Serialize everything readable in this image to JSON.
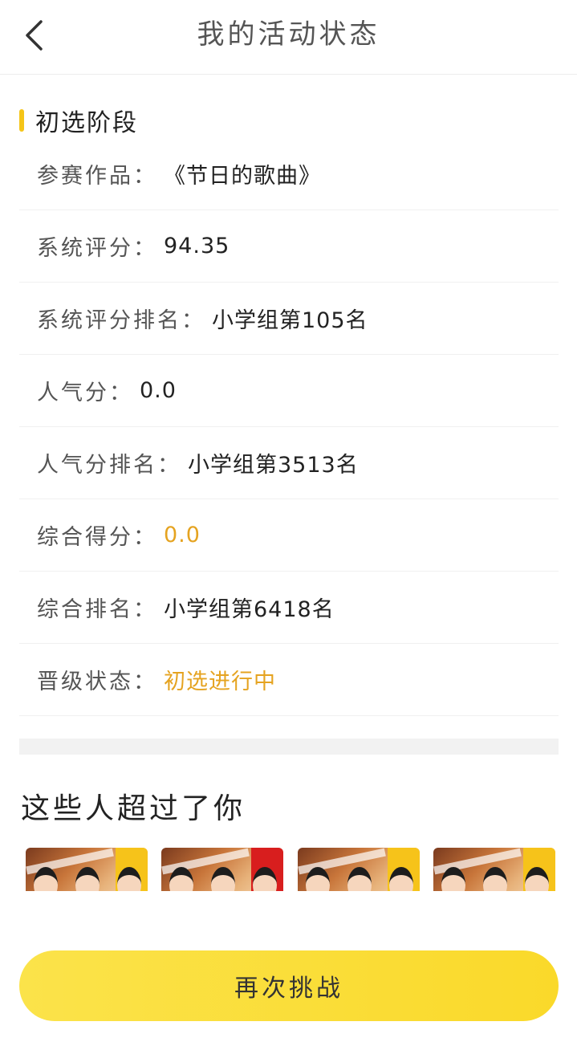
{
  "header": {
    "title": "我的活动状态",
    "back_icon": "chevron-left-icon"
  },
  "section": {
    "title": "初选阶段",
    "accent_color": "#f5c518"
  },
  "info": [
    {
      "label": "参赛作品：",
      "value": "《节日的歌曲》"
    },
    {
      "label": "系统评分：",
      "value": "94.35"
    },
    {
      "label": "系统评分排名：",
      "value": "小学组第105名"
    },
    {
      "label": "人气分：",
      "value": "0.0"
    },
    {
      "label": "人气分排名：",
      "value": "小学组第3513名"
    },
    {
      "label": "综合得分：",
      "value": "0.0"
    },
    {
      "label": "综合排名：",
      "value": "小学组第6418名"
    },
    {
      "label": "晋级状态：",
      "value": "初选进行中"
    }
  ],
  "highlight_color": "#e5a320",
  "others": {
    "title": "这些人超过了你",
    "thumbnails": 4
  },
  "cta": {
    "label": "再次挑战",
    "color": "#fad92a"
  }
}
